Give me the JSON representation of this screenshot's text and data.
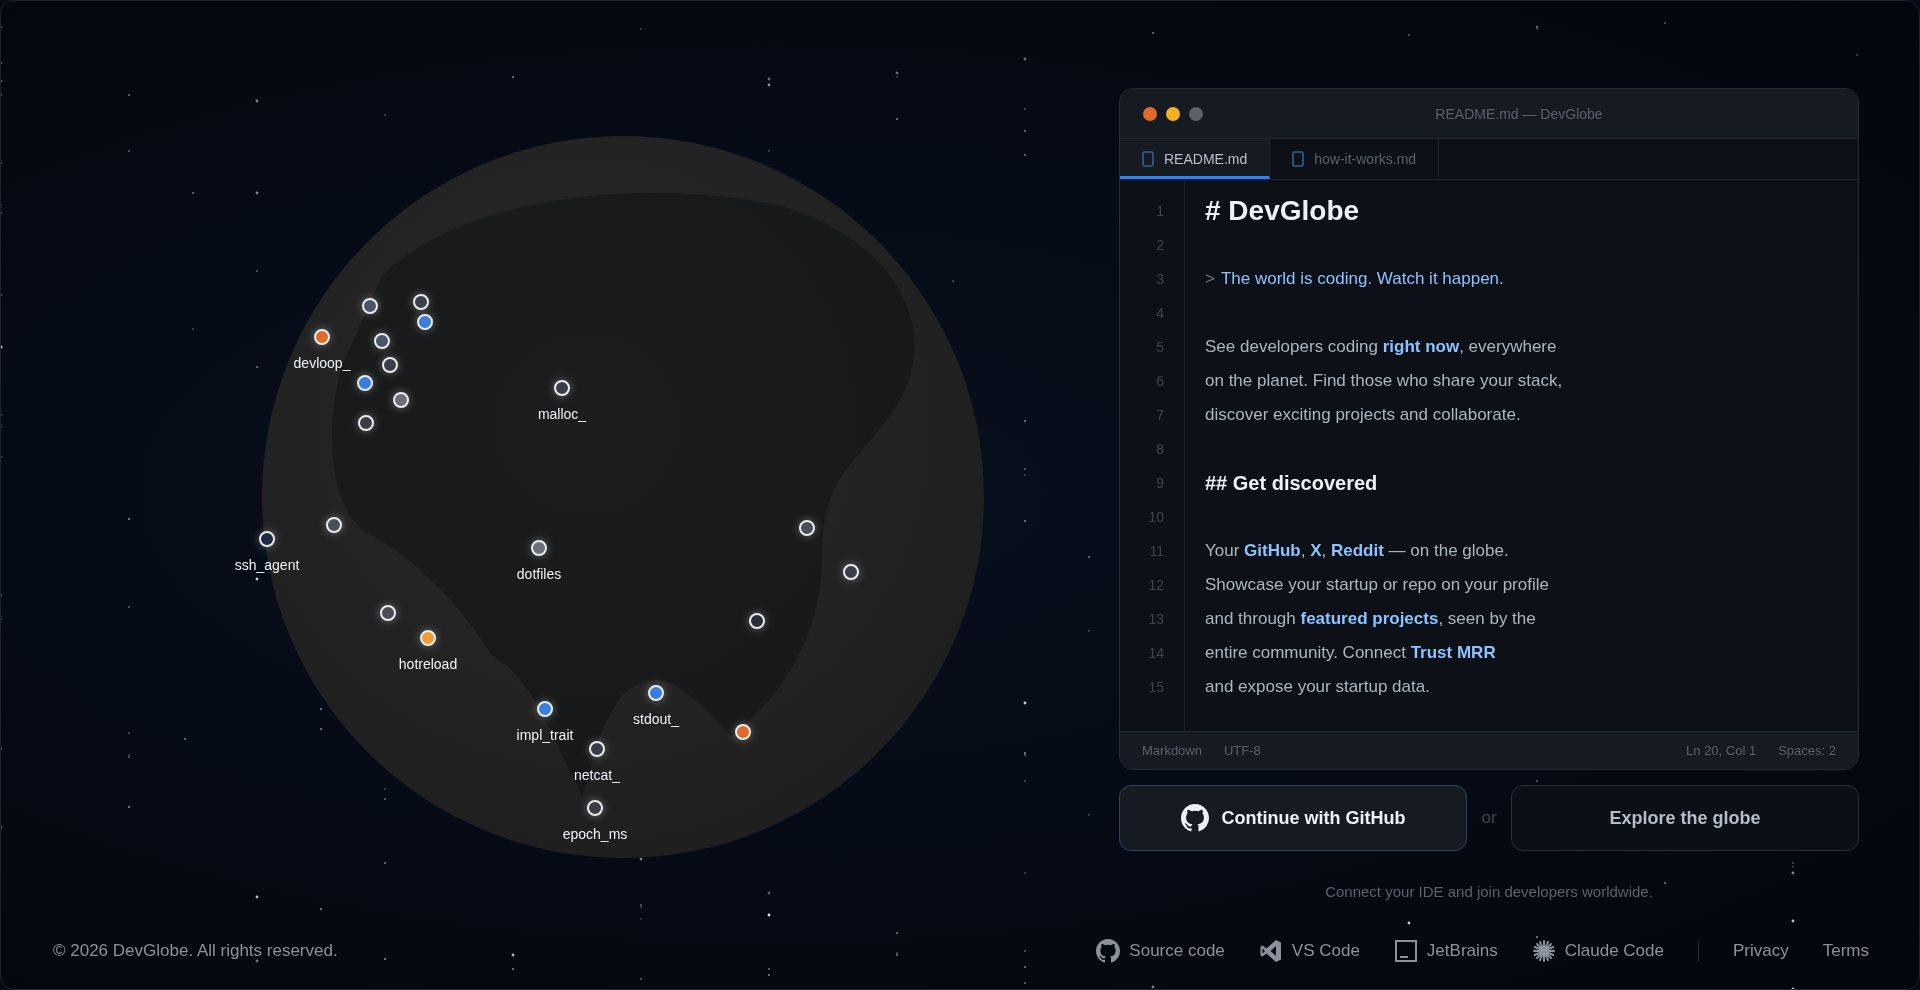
{
  "globe": {
    "pins": [
      {
        "label": "devloop_",
        "color": "#e06a2c"
      },
      {
        "color": "#4a5568"
      },
      {
        "color": "#3a3f47"
      },
      {
        "color": "#3b7ddd"
      },
      {
        "color": "#4a5568"
      },
      {
        "color": "#3a3f47"
      },
      {
        "color": "#3b7ddd"
      },
      {
        "color": "#6b7078"
      },
      {
        "color": "#3a3f47"
      },
      {
        "label": "malloc_",
        "color": "#3a3f47"
      },
      {
        "label": "ssh_agent",
        "color": "#1c2a44"
      },
      {
        "color": "#4a4f57"
      },
      {
        "label": "dotfiles",
        "color": "#6b7078"
      },
      {
        "color": "#4a4f57"
      },
      {
        "label": "hotreload",
        "color": "#f0a030"
      },
      {
        "label": "impl_trait",
        "color": "#3b7ddd"
      },
      {
        "label": "stdout_",
        "color": "#3b7ddd"
      },
      {
        "label": "netcat_",
        "color": "#3a3f47"
      },
      {
        "label": "epoch_ms",
        "color": "#3a3f47"
      },
      {
        "color": "#e06a2c"
      },
      {
        "color": "#4a4f57"
      },
      {
        "color": "#3a3f47"
      },
      {
        "color": "#2a2e35"
      }
    ]
  },
  "editor": {
    "title": "README.md — DevGlobe",
    "tabs": [
      {
        "label": "README.md",
        "selected": true
      },
      {
        "label": "how-it-works.md",
        "selected": false
      }
    ],
    "lines": [
      {
        "number": "1",
        "kind": "h1",
        "text": "# DevGlobe"
      },
      {
        "number": "2",
        "kind": "blank"
      },
      {
        "number": "3",
        "kind": "quote",
        "marker": ">",
        "text": "The world is coding. Watch it happen."
      },
      {
        "number": "4",
        "kind": "blank"
      },
      {
        "number": "5",
        "kind": "text",
        "text": "See developers coding **right now**, everywhere"
      },
      {
        "number": "6",
        "kind": "text",
        "text": "on the planet. Find those who share your stack,"
      },
      {
        "number": "7",
        "kind": "text",
        "text": "discover exciting projects and collaborate."
      },
      {
        "number": "8",
        "kind": "blank"
      },
      {
        "number": "9",
        "kind": "h2",
        "text": "## Get discovered"
      },
      {
        "number": "10",
        "kind": "blank"
      },
      {
        "number": "11",
        "kind": "text",
        "text": "Your **GitHub**, **X**, **Reddit** — on the globe."
      },
      {
        "number": "12",
        "kind": "text",
        "text": "Showcase your startup or repo on your profile"
      },
      {
        "number": "13",
        "kind": "text",
        "text": "and through **featured projects**, seen by the"
      },
      {
        "number": "14",
        "kind": "text",
        "text": "entire community. Connect **Trust MRR**"
      },
      {
        "number": "15",
        "kind": "text",
        "text": "and expose your startup data."
      }
    ],
    "status_left": [
      "Markdown",
      "UTF-8"
    ],
    "status_right": [
      "Ln 20, Col 1",
      "Spaces: 2"
    ]
  },
  "actions": {
    "primary": "Continue with GitHub",
    "separator": "or",
    "secondary": "Explore the globe",
    "caption": "Connect your IDE and join developers worldwide."
  },
  "footer": {
    "copyright": "© 2026 DevGlobe. All rights reserved.",
    "tools": [
      "Source code",
      "VS Code",
      "JetBrains",
      "Claude Code"
    ],
    "legal": [
      "Privacy",
      "Terms"
    ]
  }
}
